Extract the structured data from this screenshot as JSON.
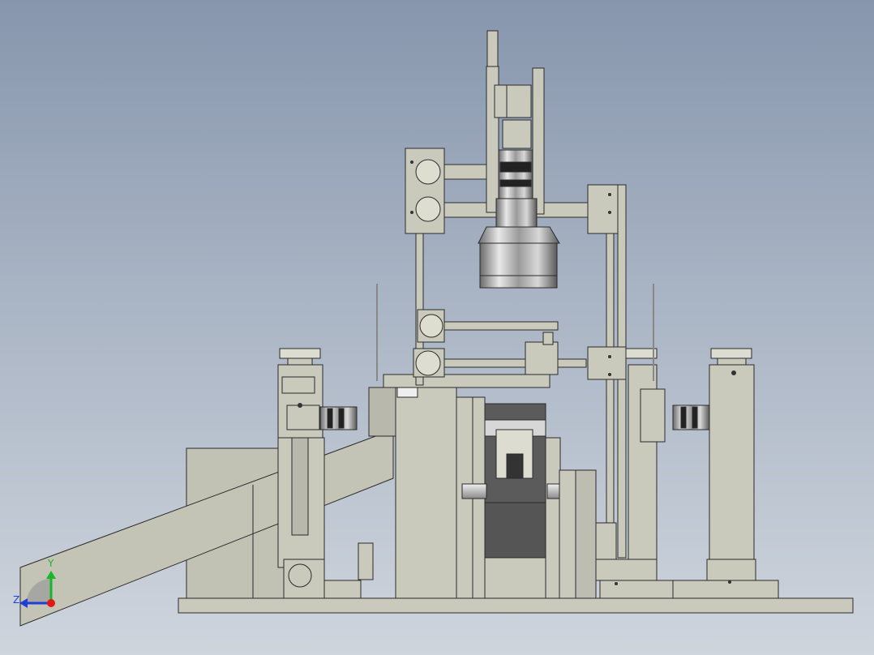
{
  "view": {
    "background_top": "#8796ad",
    "background_bottom": "#cfd5dd",
    "part_fill": "#c9c9bc",
    "part_stroke": "#2b2b2b"
  },
  "triad": {
    "y_label": "Y",
    "z_label": "Z",
    "y_color": "#19b52b",
    "z_color": "#1f3fd6",
    "x_color": "#e01818"
  }
}
